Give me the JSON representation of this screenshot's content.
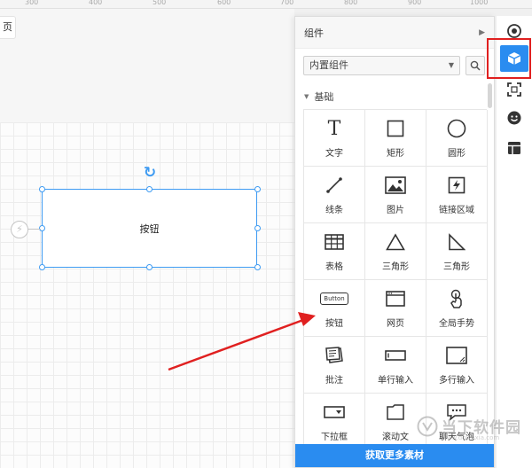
{
  "ruler": {
    "ticks": [
      "300",
      "400",
      "500",
      "600",
      "700",
      "800",
      "900",
      "1000"
    ]
  },
  "page_tab": "页",
  "canvas": {
    "shape_label": "按钮"
  },
  "panel": {
    "title": "组件",
    "library_select": "内置组件",
    "section": "基础",
    "items": [
      {
        "label": "文字",
        "icon": "text-icon"
      },
      {
        "label": "矩形",
        "icon": "rectangle-icon"
      },
      {
        "label": "圆形",
        "icon": "circle-icon"
      },
      {
        "label": "线条",
        "icon": "line-icon"
      },
      {
        "label": "图片",
        "icon": "image-icon"
      },
      {
        "label": "链接区域",
        "icon": "link-area-icon"
      },
      {
        "label": "表格",
        "icon": "table-icon"
      },
      {
        "label": "三角形",
        "icon": "triangle-icon"
      },
      {
        "label": "三角形",
        "icon": "right-triangle-icon"
      },
      {
        "label": "按钮",
        "icon": "button-icon",
        "icon_text": "Button"
      },
      {
        "label": "网页",
        "icon": "webpage-icon"
      },
      {
        "label": "全局手势",
        "icon": "gesture-icon"
      },
      {
        "label": "批注",
        "icon": "note-icon"
      },
      {
        "label": "单行输入",
        "icon": "single-input-icon"
      },
      {
        "label": "多行输入",
        "icon": "multi-input-icon"
      },
      {
        "label": "下拉框",
        "icon": "dropdown-icon"
      },
      {
        "label": "滚动文",
        "icon": "scroll-text-icon"
      },
      {
        "label": "聊天气泡",
        "icon": "chat-bubble-icon"
      }
    ],
    "footer": "获取更多素材"
  },
  "watermark": {
    "text": "当下软件园",
    "sub": "www.downxia.com"
  },
  "colors": {
    "accent": "#2a8cf0",
    "selection": "#3e9bf2",
    "highlight": "#e02020"
  }
}
